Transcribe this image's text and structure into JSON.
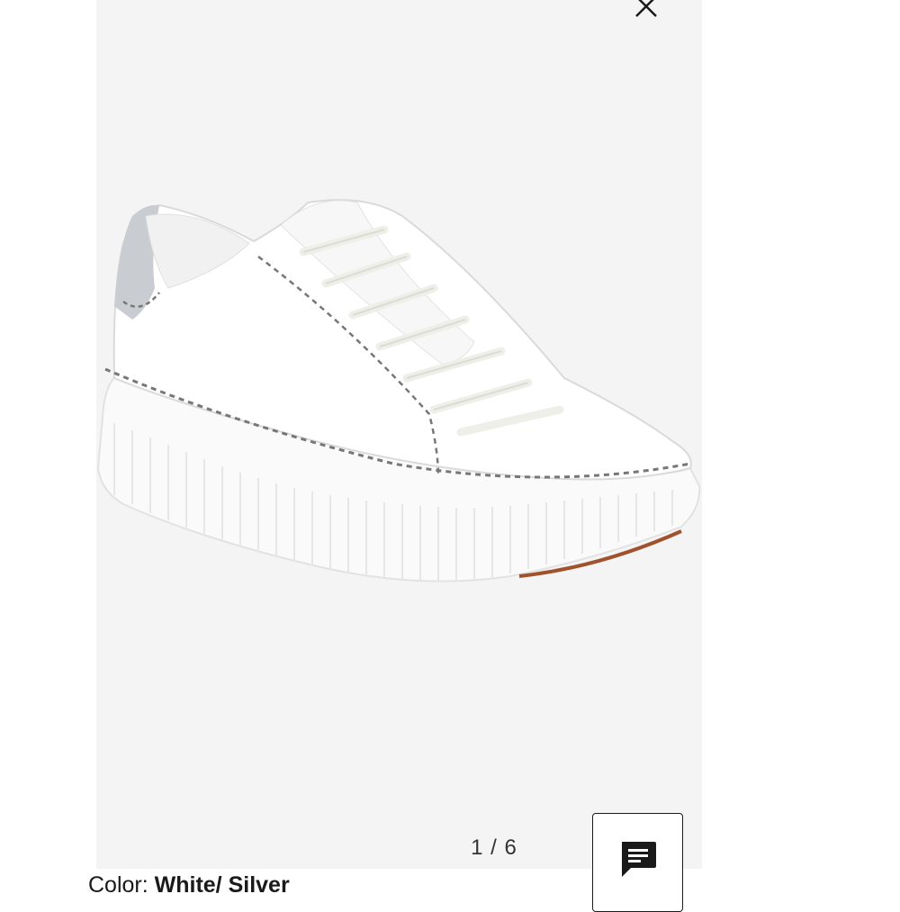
{
  "gallery": {
    "position": "1",
    "separator": "/",
    "total": "6",
    "close_icon": "close-icon"
  },
  "product": {
    "image_alt": "White leather lace-up platform sneaker with silver heel tab and contrast stitching",
    "color_label": "Color:",
    "color_value": "White/ Silver"
  },
  "chat": {
    "icon": "chat-bubble-icon"
  },
  "colors": {
    "panel_bg": "#f4f4f4",
    "accent": "#1a1a1a",
    "heel_tab": "#c9cdd2"
  }
}
